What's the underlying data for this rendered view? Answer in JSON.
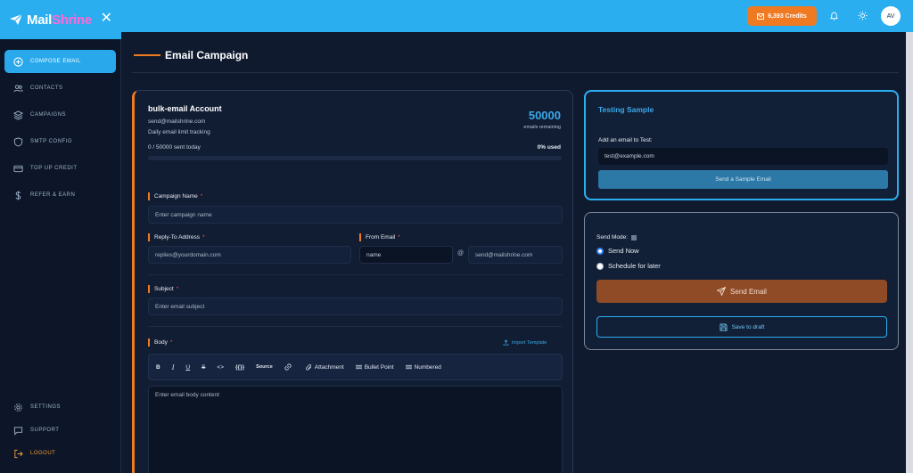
{
  "brand": {
    "logo_part1": "Mail",
    "logo_part2": "Shrine",
    "close_glyph": "✕"
  },
  "topbar": {
    "credits": "6,393 Credits",
    "avatar": "AV"
  },
  "sidebar": {
    "items": [
      {
        "label": "COMPOSE EMAIL",
        "icon": "plus-circle-icon",
        "active": true
      },
      {
        "label": "CONTACTS",
        "icon": "users-icon"
      },
      {
        "label": "CAMPAIGNS",
        "icon": "layers-icon"
      },
      {
        "label": "SMTP CONFIG",
        "icon": "shield-icon"
      },
      {
        "label": "TOP UP CREDIT",
        "icon": "credit-card-icon"
      },
      {
        "label": "REFER & EARN",
        "icon": "dollar-icon"
      }
    ],
    "bottom": [
      {
        "label": "SETTINGS",
        "icon": "gear-icon"
      },
      {
        "label": "SUPPORT",
        "icon": "chat-icon"
      },
      {
        "label": "LOGOUT",
        "icon": "logout-icon"
      }
    ]
  },
  "page": {
    "title": "Email Campaign"
  },
  "account": {
    "title": "bulk-email Account",
    "email": "send@mailshrine.com",
    "subtitle": "Daily email limit tracking",
    "remaining": "50000",
    "remaining_label": "emails remaining",
    "sent": "0 / 50000 sent today",
    "used": "0% used",
    "used_fraction": 0
  },
  "form": {
    "campaign_name_label": "Campaign Name",
    "campaign_name_placeholder": "Enter campaign name",
    "reply_to_label": "Reply-To Address",
    "reply_to_placeholder": "replies@yourdomain.com",
    "from_email_label": "From Email",
    "from_name_placeholder": "name",
    "at": "@",
    "from_domain": "send@mailshrine.com",
    "subject_label": "Subject",
    "subject_placeholder": "Enter email subject",
    "body_label": "Body",
    "import_template": "Import Template",
    "required_mark": "*",
    "body_placeholder": "Enter email body content"
  },
  "toolbar": {
    "bold": "B",
    "italic": "I",
    "underline": "U",
    "strike": "S",
    "code": "<>",
    "variable": "{{}}",
    "source": "Source",
    "attachment": "Attachment",
    "bullet": "Bullet Point",
    "numbered": "Numbered"
  },
  "testing": {
    "title": "Testing Sample",
    "label": "Add an email to Test:",
    "input_value": "test@example.com",
    "button": "Send a Sample Email"
  },
  "send": {
    "mode_label": "Send Mode:",
    "option_now": "Send Now",
    "option_later": "Schedule for later",
    "selected": "Send Now",
    "send_button": "Send Email",
    "draft_button": "Save to draft"
  },
  "colors": {
    "accent": "#2aaef0",
    "orange": "#f07a22",
    "brand_pink": "#ff6ad5"
  }
}
